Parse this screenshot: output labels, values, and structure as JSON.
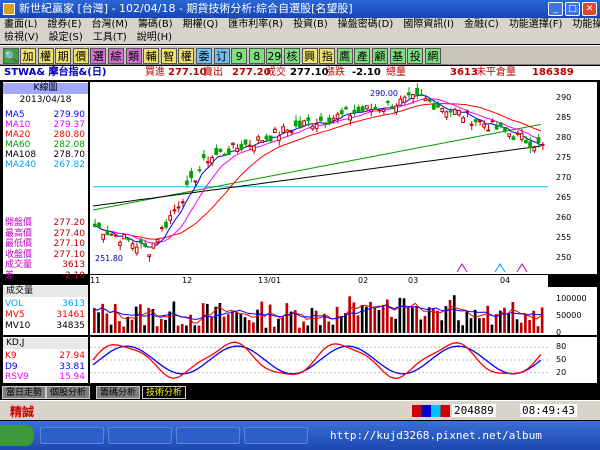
{
  "window": {
    "title": "新世紀贏家 [台灣] - 102/04/18 - 期貨技術分析:綜合自選股[名望股]"
  },
  "menu1": [
    "畫面(L)",
    "證券(E)",
    "台灣(M)",
    "籌碼(B)",
    "期權(Q)",
    "匯市利率(R)",
    "投資(B)",
    "操盤密碼(D)",
    "國際資訊(I)",
    "金融(C)",
    "功能選擇(F)",
    "功能操作(F)"
  ],
  "menu2": [
    "檢視(V)",
    "設定(S)",
    "工具(T)",
    "說明(H)"
  ],
  "toolbar": [
    {
      "label": "加",
      "color": "#f0e070"
    },
    {
      "label": "權",
      "color": "#f0e070"
    },
    {
      "label": "期",
      "color": "#f0e070"
    },
    {
      "label": "價",
      "color": "#f0e070"
    },
    {
      "label": "選",
      "color": "#d070d0"
    },
    {
      "label": "綜",
      "color": "#d070d0"
    },
    {
      "label": "類",
      "color": "#d070d0"
    },
    {
      "label": "輔",
      "color": "#f0e070"
    },
    {
      "label": "智",
      "color": "#f0e070"
    },
    {
      "label": "權",
      "color": "#f0e070"
    },
    {
      "label": "委",
      "color": "#70c0f0"
    },
    {
      "label": "订",
      "color": "#70c0f0"
    },
    {
      "label": "9",
      "color": "#80e080"
    },
    {
      "label": "8",
      "color": "#80e080"
    },
    {
      "label": "29",
      "color": "#80e080"
    },
    {
      "label": "核",
      "color": "#80e080"
    },
    {
      "label": "興",
      "color": "#f0e070"
    },
    {
      "label": "指",
      "color": "#f0e070"
    },
    {
      "label": "鷹",
      "color": "#80e080"
    },
    {
      "label": "產",
      "color": "#80e080"
    },
    {
      "label": "顧",
      "color": "#80e080"
    },
    {
      "label": "基",
      "color": "#80e080"
    },
    {
      "label": "投",
      "color": "#80e080"
    },
    {
      "label": "網",
      "color": "#80e080"
    }
  ],
  "quote": {
    "symbol": "STWA& 摩台指&(日)",
    "buy_label": "買進",
    "buy": "277.10",
    "sell_label": "賣出",
    "sell": "277.20",
    "deal_label": "成交",
    "deal": "277.10",
    "change_label": "漲跌",
    "change": "-2.10",
    "volume_label": "總量",
    "volume": "3613",
    "oi_label": "未平倉量",
    "oi": "186389"
  },
  "kline_panel": {
    "title": "K線圖",
    "date": "2013/04/18",
    "ma": [
      {
        "name": "MA5",
        "value": "279.90",
        "color": "#0000ff"
      },
      {
        "name": "MA10",
        "value": "279.37",
        "color": "#ff00ff"
      },
      {
        "name": "MA20",
        "value": "280.80",
        "color": "#ff0000"
      },
      {
        "name": "MA60",
        "value": "282.08",
        "color": "#00a000"
      },
      {
        "name": "MA108",
        "value": "278.70",
        "color": "#000000"
      },
      {
        "name": "MA240",
        "value": "267.82",
        "color": "#00a0ff"
      }
    ],
    "stats": [
      {
        "name": "開盤價",
        "value": "277.20"
      },
      {
        "name": "最高價",
        "value": "277.40"
      },
      {
        "name": "最低價",
        "value": "277.10"
      },
      {
        "name": "收盤價",
        "value": "277.10"
      },
      {
        "name": "成交量",
        "value": "3613"
      },
      {
        "name": "差",
        "value": "-2.10"
      }
    ]
  },
  "volume_panel": {
    "title": "成交量",
    "rows": [
      {
        "name": "VOL",
        "value": "3613",
        "color": "#00a0ff"
      },
      {
        "name": "MV5",
        "value": "31461",
        "color": "#ff0000"
      },
      {
        "name": "MV10",
        "value": "34835",
        "color": "#000000"
      }
    ]
  },
  "kd_panel": {
    "title": "KD,J",
    "rows": [
      {
        "name": "K9",
        "value": "27.94",
        "color": "#ff0000"
      },
      {
        "name": "D9",
        "value": "33.81",
        "color": "#0000ff"
      },
      {
        "name": "RSV9",
        "value": "15.94",
        "color": "#ff00ff"
      }
    ]
  },
  "dates": [
    "11",
    "12",
    "13/01",
    "02",
    "03",
    "04"
  ],
  "chart_data": [
    {
      "type": "candlestick",
      "price_high_marker": "290.00",
      "price_low_marker": "251.80",
      "ylim": [
        247,
        293
      ],
      "yticks": [
        "290",
        "285",
        "280",
        "275",
        "270",
        "265",
        "260",
        "255",
        "250"
      ]
    },
    {
      "type": "bar",
      "ylim": [
        0,
        130000
      ],
      "yticks": [
        "100000",
        "50000",
        "0"
      ]
    },
    {
      "type": "line",
      "ylim": [
        0,
        100
      ],
      "yticks": [
        "80",
        "50",
        "20"
      ]
    }
  ],
  "tabs": [
    "當日走勢",
    "個股分析",
    "籌碼分析",
    "技術分析"
  ],
  "status": {
    "brand": "精誠",
    "counter": "204889",
    "clock": "08:49:43"
  },
  "taskbar": {
    "items": [
      "",
      "",
      "",
      "",
      ""
    ],
    "watermark": "http://kujd3268.pixnet.net/album"
  }
}
